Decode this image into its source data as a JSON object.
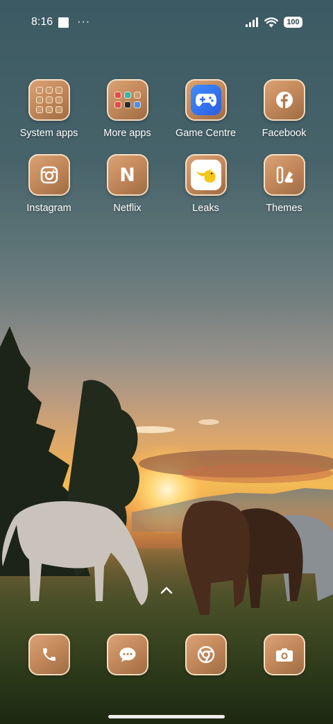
{
  "status_bar": {
    "time": "8:16",
    "more_notifications": "···",
    "battery_level": "100"
  },
  "apps": [
    {
      "label": "System apps",
      "icon": "folder-icon"
    },
    {
      "label": "More apps",
      "icon": "folder-icon"
    },
    {
      "label": "Game Centre",
      "icon": "gamepad-icon"
    },
    {
      "label": "Facebook",
      "icon": "facebook-icon"
    },
    {
      "label": "Instagram",
      "icon": "camera-outline-icon"
    },
    {
      "label": "Netflix",
      "icon": "netflix-n-icon",
      "glyph": "N"
    },
    {
      "label": "Leaks",
      "icon": "bird-icon"
    },
    {
      "label": "Themes",
      "icon": "themes-icon"
    }
  ],
  "dock": [
    {
      "name": "phone",
      "icon": "phone-icon"
    },
    {
      "name": "messages",
      "icon": "message-bubble-icon"
    },
    {
      "name": "chrome",
      "icon": "chrome-icon"
    },
    {
      "name": "camera",
      "icon": "camera-icon"
    }
  ],
  "colors": {
    "icon_gradient_start": "#dba477",
    "icon_gradient_end": "#9c6a42",
    "icon_border": "#ffecd2",
    "game_centre_blue": "#3f8cff",
    "leaks_yellow": "#f5c518"
  }
}
